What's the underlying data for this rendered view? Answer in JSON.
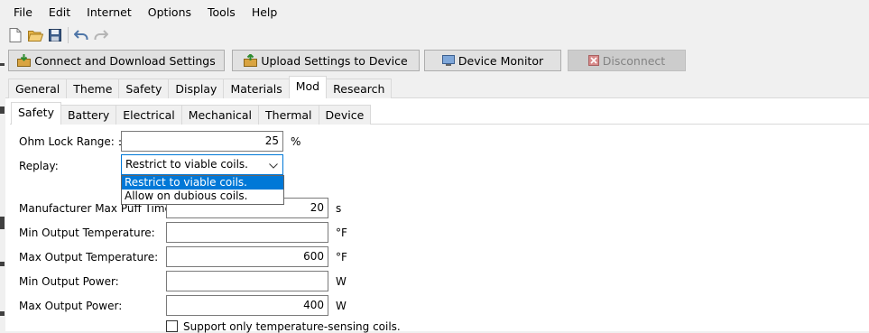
{
  "menu": [
    "File",
    "Edit",
    "Internet",
    "Options",
    "Tools",
    "Help"
  ],
  "toolbar_icons": [
    "new-file-icon",
    "open-folder-icon",
    "save-icon",
    "undo-icon",
    "redo-icon"
  ],
  "actions": {
    "connect": "Connect and Download Settings",
    "upload": "Upload Settings to Device",
    "monitor": "Device Monitor",
    "disconnect": "Disconnect"
  },
  "main_tabs": [
    "General",
    "Theme",
    "Safety",
    "Display",
    "Materials",
    "Mod",
    "Research"
  ],
  "main_active": "Mod",
  "sub_tabs": [
    "Safety",
    "Battery",
    "Electrical",
    "Mechanical",
    "Thermal",
    "Device"
  ],
  "sub_active": "Safety",
  "form": {
    "ohm_lock_label": "Ohm Lock Range: ±",
    "ohm_lock_value": "25",
    "ohm_lock_unit": "%",
    "replay_label": "Replay:",
    "replay_value": "Restrict to viable coils.",
    "replay_options": [
      "Restrict to viable coils.",
      "Allow on dubious coils."
    ],
    "max_puff_label": "Manufacturer Max Puff Time:",
    "max_puff_value": "20",
    "max_puff_unit": "s",
    "min_temp_label": "Min Output Temperature:",
    "min_temp_value": "",
    "min_temp_unit": "°F",
    "max_temp_label": "Max Output Temperature:",
    "max_temp_value": "600",
    "max_temp_unit": "°F",
    "min_power_label": "Min Output Power:",
    "min_power_value": "",
    "min_power_unit": "W",
    "max_power_label": "Max Output Power:",
    "max_power_value": "400",
    "max_power_unit": "W",
    "temp_sensing_label": "Support only temperature-sensing coils."
  },
  "colors": {
    "accent": "#0078d7",
    "window_bg": "#f0f0f0",
    "panel_bg": "#ffffff"
  }
}
